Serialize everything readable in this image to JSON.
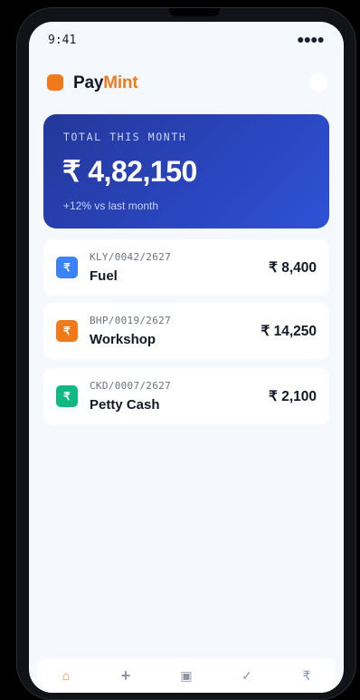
{
  "status_bar": {
    "time": "9:41",
    "indicator": "●●●●"
  },
  "header": {
    "brand_part1": "Pay",
    "brand_part2": "Mint"
  },
  "summary": {
    "label": "TOTAL THIS MONTH",
    "amount": "₹ 4,82,150",
    "delta": "+12% vs last month"
  },
  "transactions": [
    {
      "code": "KLY/0042/2627",
      "name": "Fuel",
      "amount": "₹ 8,400",
      "icon": "₹",
      "icon_color": "#3b82f6"
    },
    {
      "code": "BHP/0019/2627",
      "name": "Workshop",
      "amount": "₹ 14,250",
      "icon": "₹",
      "icon_color": "#f07a1a"
    },
    {
      "code": "CKD/0007/2627",
      "name": "Petty Cash",
      "amount": "₹ 2,100",
      "icon": "₹",
      "icon_color": "#10b981"
    }
  ],
  "tab_bar": {
    "home": "⌂",
    "add": "+",
    "scan": "▣",
    "approve": "✓",
    "payments": "₹"
  },
  "colors": {
    "accent": "#f07a1a",
    "card_gradient_start": "#24389a",
    "card_gradient_end": "#2e52d6",
    "background": "#f5f8fc"
  }
}
